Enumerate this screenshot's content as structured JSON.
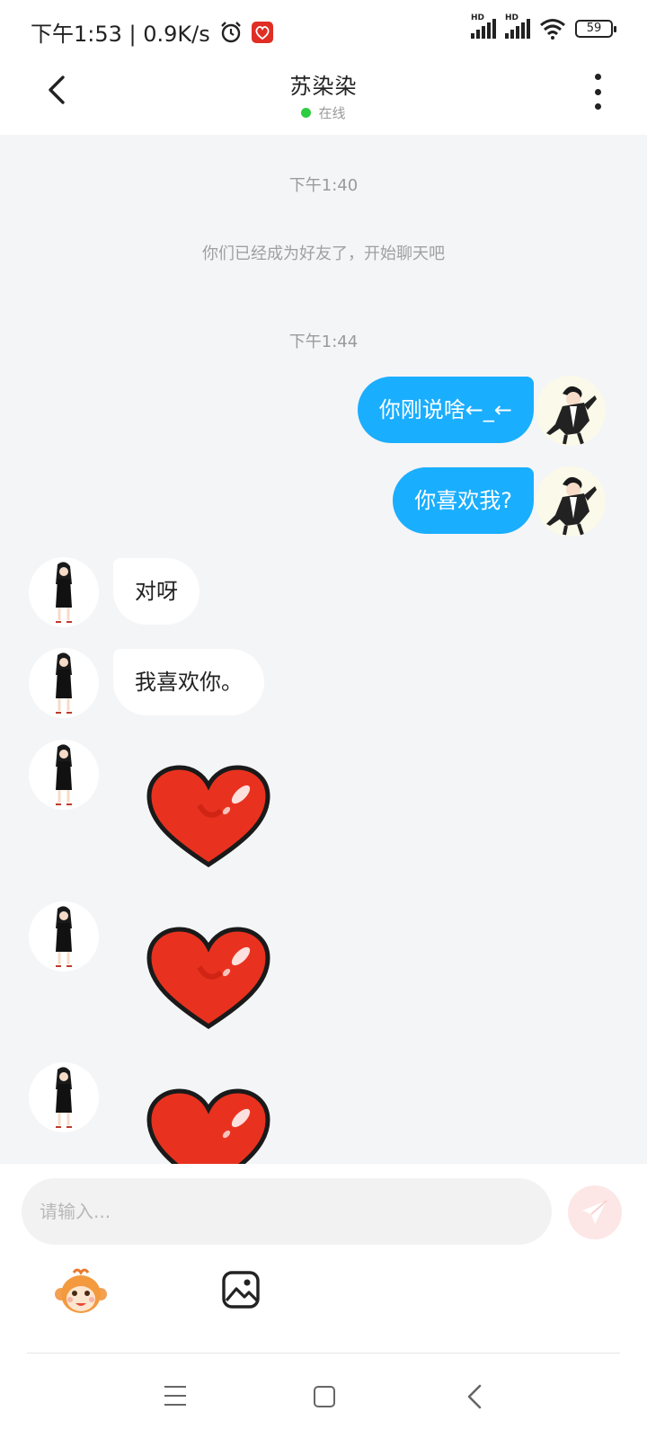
{
  "status_bar": {
    "time_speed": "下午1:53 | 0.9K/s",
    "hd1": "HD",
    "hd2": "HD",
    "battery": "59"
  },
  "header": {
    "title": "苏染染",
    "online_status": "在线"
  },
  "chat": {
    "timestamp_1": "下午1:40",
    "system_message": "你们已经成为好友了，开始聊天吧",
    "timestamp_2": "下午1:44",
    "messages": [
      {
        "from": "me",
        "text": "你刚说啥←_←"
      },
      {
        "from": "me",
        "text": "你喜欢我?"
      },
      {
        "from": "her",
        "text": "对呀"
      },
      {
        "from": "her",
        "text": "我喜欢你。"
      },
      {
        "from": "her",
        "sticker": "heart-sticker"
      },
      {
        "from": "her",
        "sticker": "heart-sticker"
      },
      {
        "from": "her",
        "sticker": "heart-sticker"
      }
    ]
  },
  "input_panel": {
    "placeholder": "请输入...",
    "send_icon": "paper-plane-icon",
    "emoji_icon": "monkey-face-icon",
    "image_icon": "image-icon"
  },
  "nav": {
    "menu_icon": "menu-icon",
    "home_icon": "home-icon",
    "back_icon": "back-icon"
  },
  "colors": {
    "my_bubble": "#1aaeff",
    "her_bubble": "#ffffff",
    "chat_bg": "#f4f5f7",
    "online_dot": "#2ecc40",
    "send_button": "#fde6e6"
  }
}
